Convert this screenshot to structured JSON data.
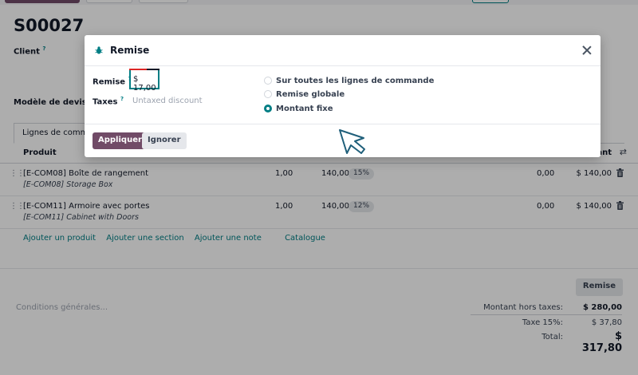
{
  "form": {
    "title": "S00027",
    "client_label": "Client",
    "modele_label": "Modèle de devis",
    "help_mark": "?",
    "tab_label": "Lignes de commande"
  },
  "table": {
    "col_produit": "Produit",
    "col_montant": "ant",
    "settings_icon": "⇄",
    "rows": [
      {
        "name": "[E-COM08] Boîte de rangement",
        "desc": "[E-COM08] Storage Box",
        "qty": "1,00",
        "price": "140,00",
        "tax": "15%",
        "discount": "0,00",
        "subtotal": "$ 140,00"
      },
      {
        "name": "[E-COM11] Armoire avec portes",
        "desc": "[E-COM11] Cabinet with Doors",
        "qty": "1,00",
        "price": "140,00",
        "tax": "12%",
        "discount": "0,00",
        "subtotal": "$ 140,00"
      }
    ],
    "add_product": "Ajouter un produit",
    "add_section": "Ajouter une section",
    "add_note": "Ajouter une note",
    "catalog": "Catalogue"
  },
  "footer": {
    "remise_button": "Remise",
    "conditions_placeholder": "Conditions générales...",
    "ht_label": "Montant hors taxes:",
    "ht_value": "$ 280,00",
    "tax_label": "Taxe 15%:",
    "tax_value": "$ 37,80",
    "total_label": "Total:",
    "total_value": "$ 317,80"
  },
  "modal": {
    "title": "Remise",
    "remise_label": "Remise",
    "remise_value": "$ 17,00",
    "taxes_label": "Taxes",
    "taxes_placeholder": "Untaxed discount",
    "options": [
      {
        "label": "Sur toutes les lignes de commande",
        "selected": false
      },
      {
        "label": "Remise globale",
        "selected": false
      },
      {
        "label": "Montant fixe",
        "selected": true
      }
    ],
    "apply_label": "Appliquer",
    "ignore_label": "Ignorer"
  },
  "colors": {
    "primary": "#714b67",
    "accent": "#017e84"
  }
}
